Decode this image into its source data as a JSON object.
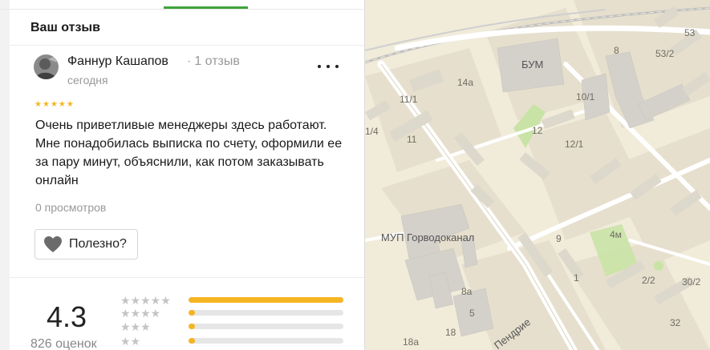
{
  "review": {
    "section_title": "Ваш отзыв",
    "author_name": "Фаннур Кашапов",
    "author_reviews": "1 отзыв",
    "date": "сегодня",
    "rating": 5,
    "text": "Очень приветливые менеджеры здесь работают. Мне понадобилась выписка по счету, оформили ее за пару минут, объяснили, как потом заказывать онлайн",
    "views": "0 просмотров",
    "useful_label": "Полезно?",
    "icons": {
      "menu": "more-dots-icon",
      "useful": "heart-icon",
      "star": "star-icon"
    }
  },
  "summary": {
    "rating": "4.3",
    "count": "826 оценок",
    "distribution": [
      {
        "stars": 5,
        "fraction": 1.0
      },
      {
        "stars": 4,
        "fraction": 0.04
      },
      {
        "stars": 3,
        "fraction": 0.04
      },
      {
        "stars": 2,
        "fraction": 0.04
      }
    ]
  },
  "colors": {
    "accent_green": "#3fa33a",
    "star_yellow": "#f5b523",
    "map_background": "#f1ebda"
  },
  "map": {
    "labels": {
      "bum": "БУМ",
      "mup": "МУП Горводоканал",
      "street": "Пендрие",
      "b53": "53",
      "b53_2": "53/2",
      "b8": "8",
      "b14a": "14а",
      "b10_1": "10/1",
      "b11_1": "11/1",
      "b12": "12",
      "b12_1": "12/1",
      "b1_4": "1/4",
      "b11": "11",
      "b9": "9",
      "b4m": "4м",
      "b1": "1",
      "b2_2": "2/2",
      "b30_2": "30/2",
      "b8a": "8а",
      "b5": "5",
      "b18": "18",
      "b32": "32",
      "b18a": "18а"
    }
  }
}
